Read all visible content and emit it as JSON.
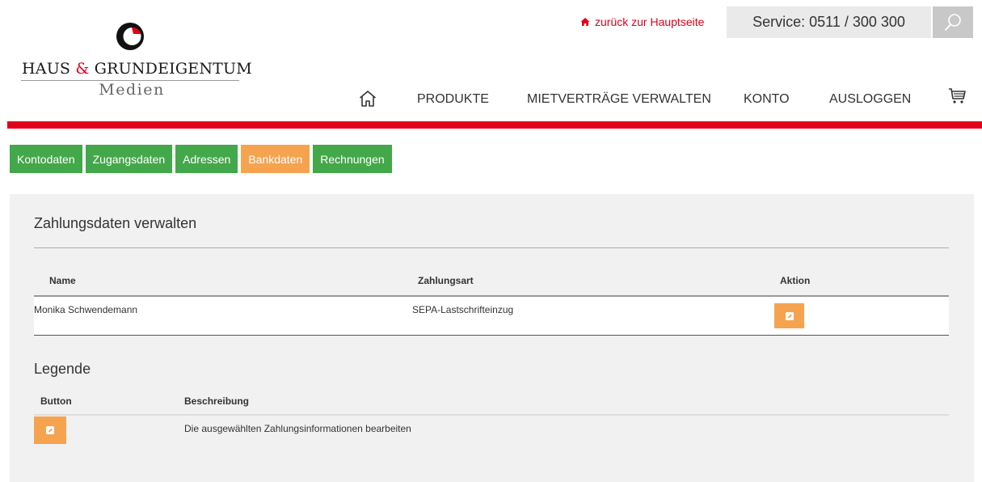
{
  "logo": {
    "mark": "logo-mark",
    "line1_part1": "HAUS",
    "line1_amp": "&",
    "line1_part2": "GRUNDEIGENTUM",
    "line2": "Medien"
  },
  "topbar": {
    "back_link": "zurück zur Hauptseite",
    "service": "Service: 0511 / 300 300",
    "search_icon": "search-icon"
  },
  "nav": {
    "home_icon": "home-icon",
    "items": [
      {
        "label": "PRODUKTE"
      },
      {
        "label": "MIETVERTRÄGE VERWALTEN"
      },
      {
        "label": "KONTO"
      },
      {
        "label": "AUSLOGGEN"
      }
    ],
    "cart_icon": "cart-icon"
  },
  "tabs": [
    {
      "label": "Kontodaten",
      "active": false
    },
    {
      "label": "Zugangsdaten",
      "active": false
    },
    {
      "label": "Adressen",
      "active": false
    },
    {
      "label": "Bankdaten",
      "active": true
    },
    {
      "label": "Rechnungen",
      "active": false
    }
  ],
  "panel": {
    "title": "Zahlungsdaten verwalten",
    "table": {
      "headers": [
        "Name",
        "Zahlungsart",
        "Aktion"
      ],
      "rows": [
        {
          "name": "Monika Schwendemann",
          "zahlungsart": "SEPA-Lastschrifteinzug",
          "action_icon": "edit-icon"
        }
      ]
    },
    "legend": {
      "title": "Legende",
      "headers": [
        "Button",
        "Beschreibung"
      ],
      "rows": [
        {
          "icon": "edit-icon",
          "description": "Die ausgewählten Zahlungsinformationen bearbeiten"
        }
      ]
    }
  },
  "colors": {
    "brand_red": "#e2001a",
    "tab_green": "#43a849",
    "tab_active_orange": "#f6a34f",
    "panel_bg": "#f1f1f1"
  }
}
